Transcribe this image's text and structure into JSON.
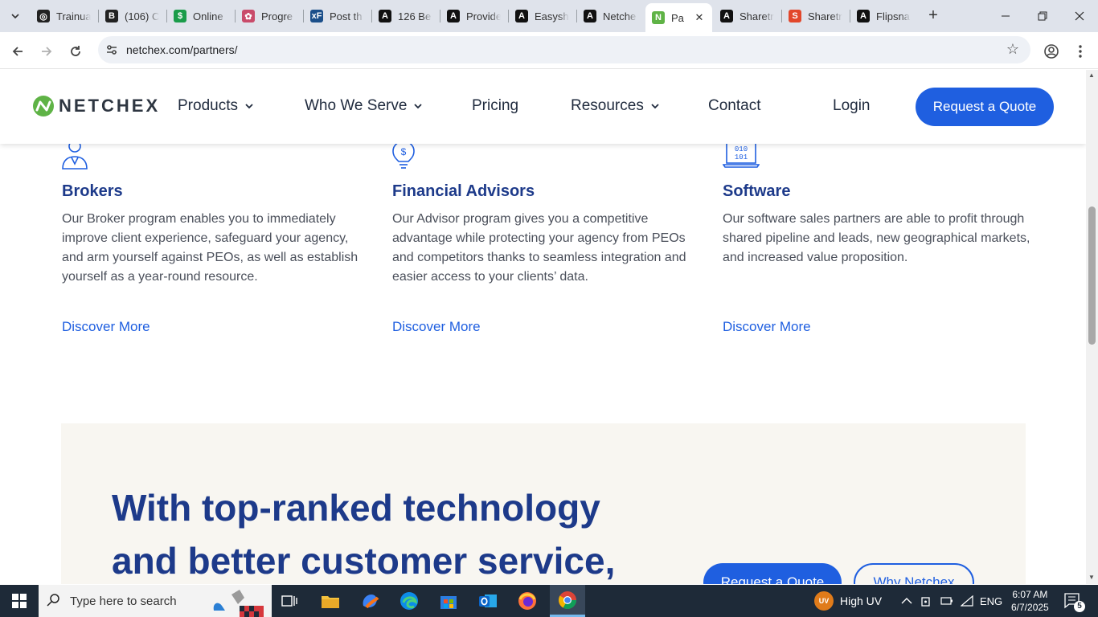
{
  "browser": {
    "tabs": [
      {
        "title": "Trainua",
        "favicon": "openai-icon",
        "color": "#222"
      },
      {
        "title": "(106) C",
        "favicon": "bitcoin-icon",
        "color": "#222"
      },
      {
        "title": "Online",
        "favicon": "dollar-leaf-icon",
        "color": "#1a9c4a"
      },
      {
        "title": "Progre",
        "favicon": "progress-icon",
        "color": "#c94b6a"
      },
      {
        "title": "Post th",
        "favicon": "xenforo-icon",
        "color": "#1b4f8a"
      },
      {
        "title": "126 Be",
        "favicon": "a-letter-icon",
        "color": "#111"
      },
      {
        "title": "Provide",
        "favicon": "a-letter-icon",
        "color": "#111"
      },
      {
        "title": "Easysh",
        "favicon": "a-letter-icon",
        "color": "#111"
      },
      {
        "title": "Netche",
        "favicon": "a-letter-icon",
        "color": "#111"
      },
      {
        "title": "Pa",
        "favicon": "netchex-icon",
        "color": "#5fb346",
        "active": true
      },
      {
        "title": "Sharetr",
        "favicon": "a-letter-icon",
        "color": "#111"
      },
      {
        "title": "Sharetr",
        "favicon": "sharetribe-icon",
        "color": "#e2472b"
      },
      {
        "title": "Flipsna",
        "favicon": "a-letter-icon",
        "color": "#111"
      }
    ],
    "url": "netchex.com/partners/"
  },
  "header": {
    "logo_text": "NETCHEX",
    "nav": [
      {
        "label": "Products",
        "dropdown": true
      },
      {
        "label": "Who We Serve",
        "dropdown": true
      },
      {
        "label": "Pricing",
        "dropdown": false
      },
      {
        "label": "Resources",
        "dropdown": true
      },
      {
        "label": "Contact",
        "dropdown": false
      },
      {
        "label": "Login",
        "dropdown": false
      }
    ],
    "cta_label": "Request a Quote"
  },
  "partners": [
    {
      "icon": "broker-person-icon",
      "title": "Brokers",
      "text": "Our Broker program enables you to immediately improve client experience, safeguard your agency, and arm yourself against PEOs, as well as establish yourself as a year-round resource.",
      "link": "Discover More"
    },
    {
      "icon": "lightbulb-dollar-icon",
      "title": "Financial Advisors",
      "text": "Our Advisor program gives you a competitive advantage while protecting your agency from PEOs and competitors thanks to seamless integration and easier access to your clients’ data.",
      "link": "Discover More"
    },
    {
      "icon": "laptop-binary-icon",
      "title": "Software",
      "text": "Our software sales partners are able to profit through shared pipeline and leads, new geographical markets, and increased value proposition.",
      "link": "Discover More"
    }
  ],
  "cta": {
    "heading": "With top-ranked technology and better customer service,",
    "primary": "Request a Quote",
    "secondary": "Why Netchex"
  },
  "taskbar": {
    "search_placeholder": "Type here to search",
    "weather": "High UV",
    "weather_badge": "UV",
    "language": "ENG",
    "time": "6:07 AM",
    "date": "6/7/2025",
    "notifications": "5"
  },
  "colors": {
    "brand_blue": "#1f5fe0",
    "heading_navy": "#1d3a8a",
    "logo_green": "#5fb346",
    "cta_bg": "#f8f6f1"
  }
}
